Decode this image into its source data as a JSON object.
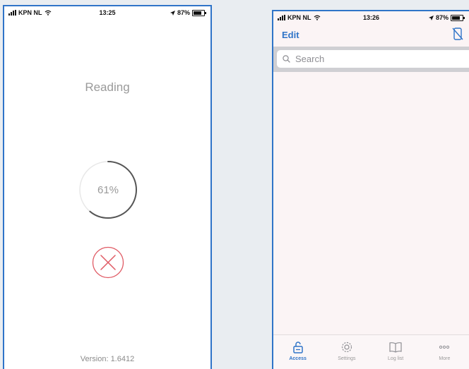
{
  "left_screen": {
    "status": {
      "carrier": "KPN NL",
      "time": "13:25",
      "battery": "87%"
    },
    "title": "Reading",
    "progress": {
      "value": 61,
      "label": "61%"
    },
    "version": "Version: 1.6412"
  },
  "right_screen": {
    "status": {
      "carrier": "KPN NL",
      "time": "13:26",
      "battery": "87%"
    },
    "nav": {
      "edit_label": "Edit"
    },
    "search": {
      "placeholder": "Search"
    },
    "tabs": [
      {
        "label": "Access",
        "icon": "unlock-icon",
        "active": true
      },
      {
        "label": "Settings",
        "icon": "gear-icon",
        "active": false
      },
      {
        "label": "Log list",
        "icon": "book-icon",
        "active": false
      },
      {
        "label": "More",
        "icon": "more-icon",
        "active": false
      }
    ]
  },
  "colors": {
    "accent": "#2f74c8",
    "cancel": "#e05a64",
    "background": "#e9edf1"
  }
}
